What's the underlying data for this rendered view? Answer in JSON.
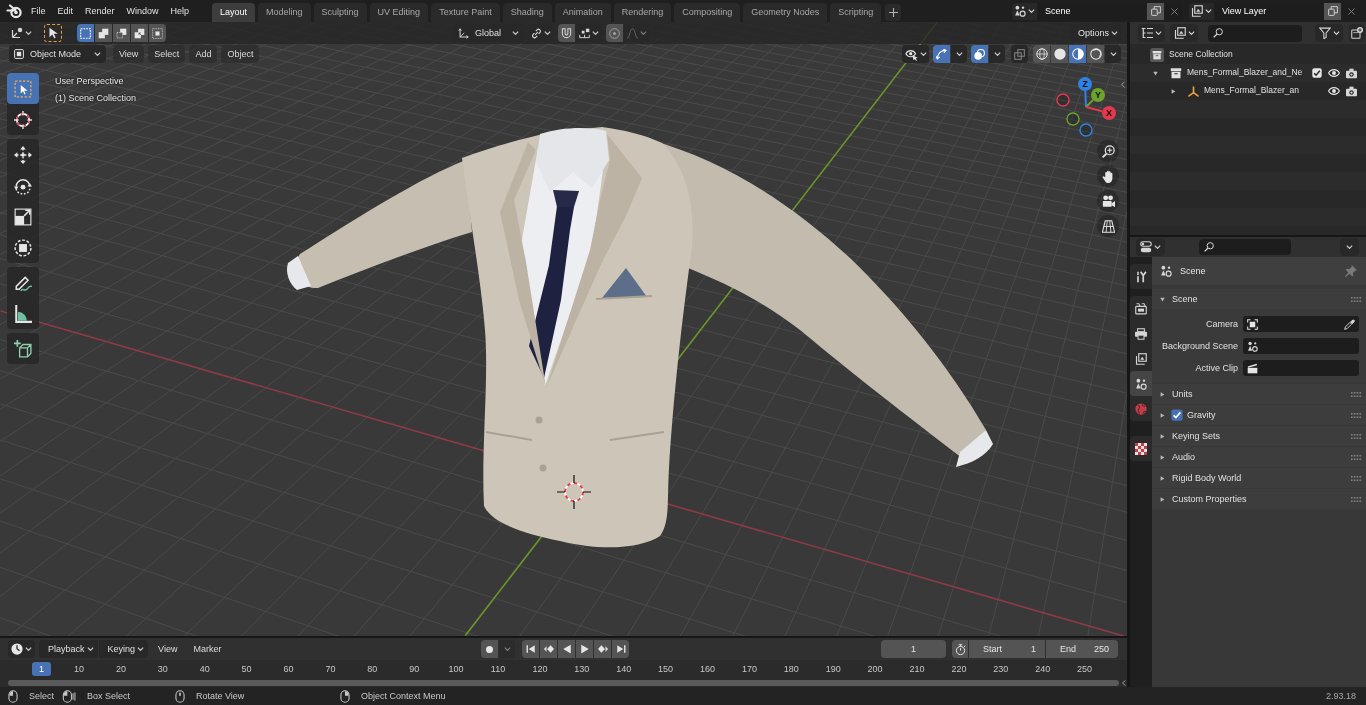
{
  "top_bar": {
    "menus": [
      "File",
      "Edit",
      "Render",
      "Window",
      "Help"
    ],
    "workspaces": [
      {
        "label": "Layout",
        "selected": true
      },
      {
        "label": "Modeling",
        "selected": false
      },
      {
        "label": "Sculpting",
        "selected": false
      },
      {
        "label": "UV Editing",
        "selected": false
      },
      {
        "label": "Texture Paint",
        "selected": false
      },
      {
        "label": "Shading",
        "selected": false
      },
      {
        "label": "Animation",
        "selected": false
      },
      {
        "label": "Rendering",
        "selected": false
      },
      {
        "label": "Compositing",
        "selected": false
      },
      {
        "label": "Geometry Nodes",
        "selected": false
      },
      {
        "label": "Scripting",
        "selected": false
      }
    ],
    "scene": "Scene",
    "view_layer": "View Layer"
  },
  "tool_header": {
    "select_modes": [
      {
        "kind": "set",
        "selected": true
      },
      {
        "kind": "extend",
        "selected": false
      },
      {
        "kind": "subtract",
        "selected": false
      },
      {
        "kind": "difference",
        "selected": false
      },
      {
        "kind": "intersect",
        "selected": false
      }
    ],
    "orientation": "Global",
    "options": "Options"
  },
  "viewport_header": {
    "mode": "Object Mode",
    "menus": [
      "View",
      "Select",
      "Add",
      "Object"
    ],
    "gizmos": {
      "on": true
    },
    "overlays": {
      "on": true
    },
    "shading": [
      {
        "kind": "wireframe",
        "selected": false
      },
      {
        "kind": "solid",
        "selected": false
      },
      {
        "kind": "material",
        "selected": true
      },
      {
        "kind": "rendered",
        "selected": false
      }
    ]
  },
  "viewport": {
    "view_name": "User Perspective",
    "collection": "(1) Scene Collection",
    "tool_groups": [
      [
        {
          "kind": "select-box",
          "selected": true
        },
        {
          "kind": "cursor",
          "selected": false
        }
      ],
      [
        {
          "kind": "move",
          "selected": false
        },
        {
          "kind": "rotate",
          "selected": false
        },
        {
          "kind": "scale",
          "selected": false
        },
        {
          "kind": "transform",
          "selected": false
        }
      ],
      [
        {
          "kind": "annotate",
          "selected": false
        },
        {
          "kind": "measure",
          "selected": false
        }
      ],
      [
        {
          "kind": "add-cube",
          "selected": false
        }
      ]
    ],
    "gizmo_axes": [
      {
        "label": "Z",
        "color": "#2e82e3"
      },
      {
        "label": "Y",
        "color": "#6ca22e"
      },
      {
        "label": "X",
        "color": "#e5384e"
      }
    ]
  },
  "outliner": {
    "tree": [
      {
        "label": "Scene Collection",
        "kind": "scene-collection",
        "children": [
          {
            "label": "Mens_Formal_Blazer_and_Ne",
            "kind": "collection",
            "expanded": true,
            "checked": true,
            "children": [
              {
                "label": "Mens_Formal_Blazer_an",
                "kind": "empty",
                "expanded": false
              }
            ]
          }
        ]
      }
    ]
  },
  "properties": {
    "tab_groups": [
      [
        {
          "kind": "tool",
          "selected": false
        }
      ],
      [
        {
          "kind": "render",
          "selected": false
        },
        {
          "kind": "output",
          "selected": false
        },
        {
          "kind": "view-layer",
          "selected": false
        },
        {
          "kind": "scene",
          "selected": true
        },
        {
          "kind": "world",
          "selected": false
        }
      ],
      [
        {
          "kind": "texture",
          "selected": false
        }
      ]
    ],
    "context": "Scene",
    "panels": [
      {
        "label": "Scene",
        "kind": "plain",
        "expanded": true,
        "fields": [
          {
            "label": "Camera",
            "kind": "camera"
          },
          {
            "label": "Background Scene",
            "kind": "scene"
          },
          {
            "label": "Active Clip",
            "kind": "clip"
          }
        ]
      },
      {
        "label": "Units",
        "kind": "plain",
        "expanded": false
      },
      {
        "label": "Gravity",
        "kind": "toggle",
        "expanded": false,
        "checked": true
      },
      {
        "label": "Keying Sets",
        "kind": "plain",
        "expanded": false
      },
      {
        "label": "Audio",
        "kind": "plain",
        "expanded": false
      },
      {
        "label": "Rigid Body World",
        "kind": "plain",
        "expanded": false
      },
      {
        "label": "Custom Properties",
        "kind": "plain",
        "expanded": false
      }
    ]
  },
  "timeline": {
    "menus": [
      {
        "label": "Playback",
        "kind": "dropdown"
      },
      {
        "label": "Keying",
        "kind": "dropdown"
      },
      {
        "label": "View",
        "kind": "menu"
      },
      {
        "label": "Marker",
        "kind": "menu"
      }
    ],
    "current_frame": "1",
    "start": {
      "label": "Start",
      "value": "1"
    },
    "end": {
      "label": "End",
      "value": "250"
    },
    "playhead": "1",
    "ruler": [
      "10",
      "20",
      "30",
      "40",
      "50",
      "60",
      "70",
      "80",
      "90",
      "100",
      "110",
      "120",
      "130",
      "140",
      "150",
      "160",
      "170",
      "180",
      "190",
      "200",
      "210",
      "220",
      "230",
      "240",
      "250"
    ]
  },
  "status_bar": {
    "hints": [
      {
        "label": "Select",
        "kind": "left-click"
      },
      {
        "label": "Box Select",
        "kind": "left-drag"
      },
      {
        "label": "Rotate View",
        "kind": "middle-click"
      },
      {
        "label": "Object Context Menu",
        "kind": "right-click"
      }
    ],
    "version": "2.93.18"
  }
}
